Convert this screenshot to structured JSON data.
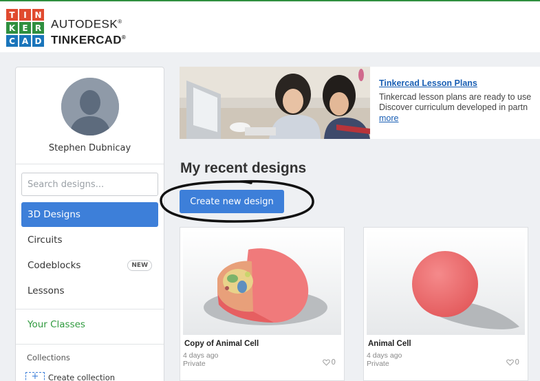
{
  "brand": {
    "logo_letters": [
      "T",
      "I",
      "N",
      "K",
      "E",
      "R",
      "C",
      "A",
      "D"
    ],
    "logo_colors": [
      "#e04a2f",
      "#e04a2f",
      "#e04a2f",
      "#2f8f3f",
      "#2f8f3f",
      "#2f8f3f",
      "#1a75bb",
      "#1a75bb",
      "#1a75bb"
    ],
    "line1": "AUTODESK",
    "reg_mark": "®",
    "line2": "TINKERCAD",
    "line2_mark": "®"
  },
  "sidebar": {
    "username": "Stephen Dubnicay",
    "search_placeholder": "Search designs...",
    "items": [
      {
        "label": "3D Designs",
        "active": true
      },
      {
        "label": "Circuits"
      },
      {
        "label": "Codeblocks",
        "badge": "NEW"
      },
      {
        "label": "Lessons"
      }
    ],
    "classes_label": "Your Classes",
    "collections_title": "Collections",
    "create_collection": "Create collection",
    "plus": "+"
  },
  "banner": {
    "title": "Tinkercad Lesson Plans",
    "line1": "Tinkercad lesson plans are ready to use",
    "line2": "Discover curriculum developed in partn",
    "more": "more"
  },
  "main": {
    "heading": "My recent designs",
    "create_button": "Create new design"
  },
  "designs": [
    {
      "title": "Copy of Animal Cell",
      "date": "4 days ago",
      "privacy": "Private",
      "likes": "0"
    },
    {
      "title": "Animal Cell",
      "date": "4 days ago",
      "privacy": "Private",
      "likes": "0"
    }
  ],
  "colors": {
    "accent": "#3d7fd9",
    "classes_green": "#2f9a3e",
    "link": "#1a5fb4",
    "model_red": "#ef6f70"
  }
}
